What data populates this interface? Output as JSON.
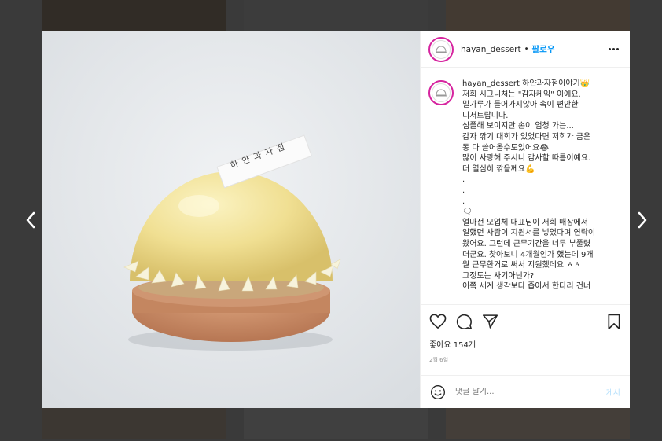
{
  "post": {
    "username": "hayan_dessert",
    "follow_label": "팔로우",
    "photo_tag_text": "하 얀 과 자 점",
    "caption_lines": [
      "저희 시그니처는 \"감자케익\" 이예요.",
      "밀가루가 들어가지않아 속이 편안한",
      "디저트랍니다.",
      "심플해 보이지만 손이 엄청 가는...",
      "감자 깎기 대회가 있었다면 저희가 금은",
      "동 다 쓸어올수도있어요😂",
      "많이 사랑해 주시니 감사할 따름이예요.",
      "더 열심히 깎을께요💪",
      ".",
      ".",
      ".",
      "🗨",
      "얼마전 모업체 대표님이 저희 매장에서",
      "일했던 사람이 지원서를 넣었다며 연락이",
      "왔어요. 그런데 근무기간을 너무 부풀렸",
      "더군요. 찾아보니 4개월인가 했는데 9개",
      "월 근무한거로 써서 지원했데요 ㅎㅎ",
      "그정도는 사기아닌가?",
      "이쪽 세계 생각보다 좁아서 한다리 건너"
    ],
    "caption_first_line_text": "하얀과자점이야기👑",
    "likes_text": "좋아요 154개",
    "date_text": "2월 6일",
    "comment_placeholder": "댓글 달기...",
    "post_button_label": "게시"
  },
  "icons": {
    "like": "heart-icon",
    "comment": "comment-icon",
    "share": "share-icon",
    "save": "bookmark-icon",
    "emoji": "smiley-icon",
    "more": "more-options-icon",
    "prev": "chevron-left-icon",
    "next": "chevron-right-icon"
  },
  "colors": {
    "follow": "#0095f6",
    "avatar_ring": "#d6249f",
    "muted": "#8e8e8e"
  }
}
